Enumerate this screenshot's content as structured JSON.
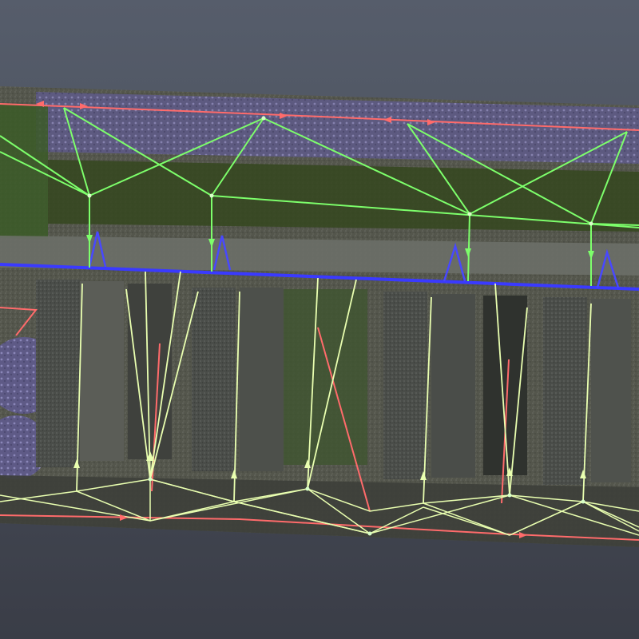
{
  "viewer": {
    "background_colors": [
      "#565d6b",
      "#3a3d47"
    ],
    "point_cloud": {
      "strip_color": "#4e5246",
      "vegetation_color": "#6f6a9a",
      "grass_color": "#3f5a2c",
      "roof_color": "#5a5d57",
      "shadow_color": "#2b2e2a"
    },
    "overlays": {
      "path_line_color": "#ff6b6b",
      "network_line_color": "#7dff6b",
      "pale_line_color": "#e9ffb0",
      "axis_line_color": "#3a3aff",
      "marker_icon": "triangle-marker-icon"
    }
  }
}
